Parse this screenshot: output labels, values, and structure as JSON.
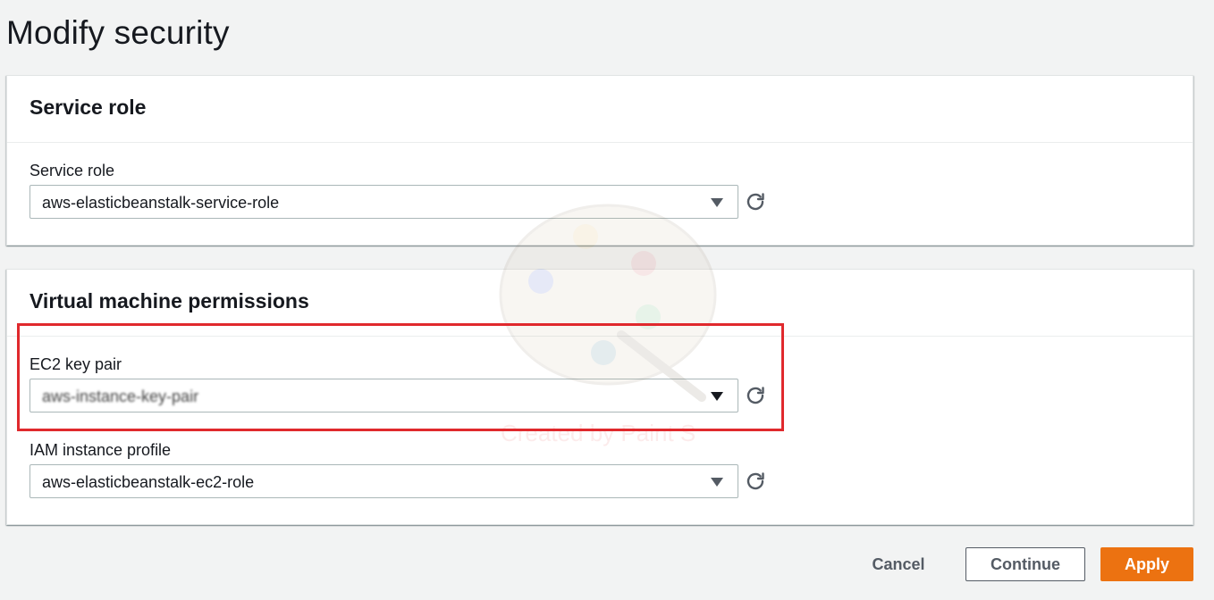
{
  "page": {
    "title": "Modify security"
  },
  "service_role_panel": {
    "heading": "Service role",
    "field": {
      "label": "Service role",
      "value": "aws-elasticbeanstalk-service-role"
    }
  },
  "vm_permissions_panel": {
    "heading": "Virtual machine permissions",
    "ec2_key_pair": {
      "label": "EC2 key pair",
      "value": "aws-instance-key-pair"
    },
    "iam_instance_profile": {
      "label": "IAM instance profile",
      "value": "aws-elasticbeanstalk-ec2-role"
    }
  },
  "watermark": {
    "text": "Created by Paint S"
  },
  "actions": {
    "cancel_label": "Cancel",
    "continue_label": "Continue",
    "apply_label": "Apply"
  },
  "colors": {
    "accent": "#ec7211",
    "highlight": "#e0292d",
    "background": "#f2f3f3"
  },
  "icons": {
    "refresh": "refresh-icon",
    "dropdown": "caret-down-icon"
  }
}
